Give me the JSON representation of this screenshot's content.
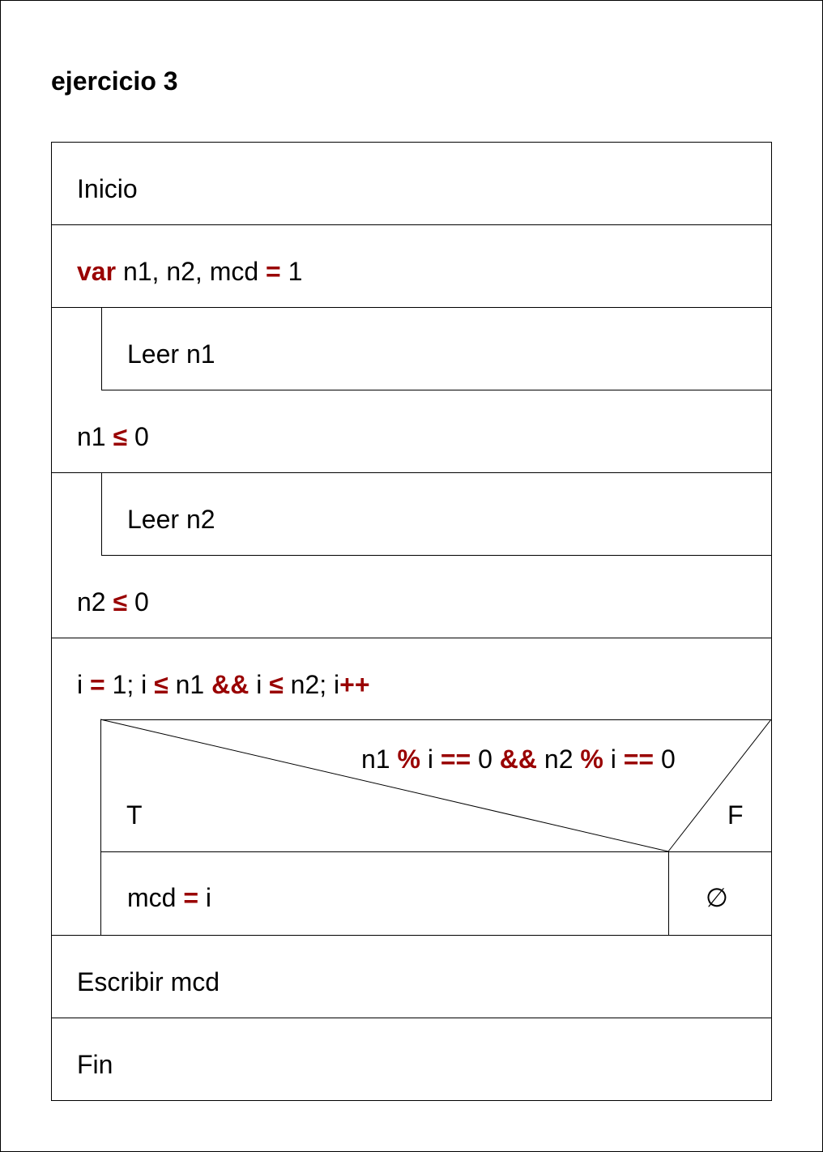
{
  "title": "ejercicio 3",
  "blocks": {
    "inicio": "Inicio",
    "declare": {
      "kw_var": "var",
      "vars": "n1, n2, mcd",
      "op_assign": "=",
      "init": "1"
    },
    "loop1": {
      "body": "Leer n1",
      "cond_left": "n1",
      "op": "≤",
      "cond_right": "0"
    },
    "loop2": {
      "body": "Leer n2",
      "cond_left": "n2",
      "op": "≤",
      "cond_right": "0"
    },
    "for_loop": {
      "p1": "i",
      "op1": "=",
      "p2": "1; i",
      "op2": "≤",
      "p3": "n1",
      "op3": "&&",
      "p4": "i",
      "op4": "≤",
      "p5": "n2; i",
      "op5": "++"
    },
    "if": {
      "c1": "n1",
      "op1": "%",
      "c2": "i",
      "op2": "==",
      "c3": "0",
      "op3": "&&",
      "c4": "n2",
      "op4": "%",
      "c5": "i",
      "op5": "==",
      "c6": "0",
      "true_label": "T",
      "false_label": "F",
      "true_body": {
        "lhs": "mcd",
        "op": "=",
        "rhs": "i"
      },
      "false_body": "∅"
    },
    "escribir": "Escribir mcd",
    "fin": "Fin"
  }
}
